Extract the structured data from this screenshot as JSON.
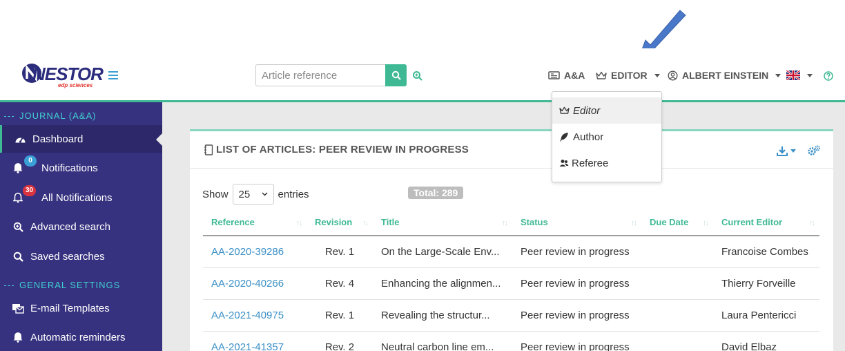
{
  "brand": {
    "name": "NESTOR",
    "sub": "edp sciences"
  },
  "search": {
    "placeholder": "Article reference"
  },
  "nav": {
    "journal": "A&A",
    "role": "EDITOR",
    "user": "ALBERT EINSTEIN"
  },
  "role_menu": {
    "items": [
      {
        "label": "Editor",
        "icon": "crown-icon",
        "selected": true
      },
      {
        "label": "Author",
        "icon": "feather-icon",
        "selected": false
      },
      {
        "label": "Referee",
        "icon": "users-icon",
        "selected": false
      }
    ]
  },
  "sidebar": {
    "section_journal": "JOURNAL (A&A)",
    "section_general": "GENERAL SETTINGS",
    "items": [
      {
        "label": "Dashboard",
        "icon": "dashboard-icon"
      },
      {
        "label": "Notifications",
        "icon": "bell-icon",
        "badge": "0"
      },
      {
        "label": "All Notifications",
        "icon": "bell-outline-icon",
        "badge": "30"
      },
      {
        "label": "Advanced search",
        "icon": "search-plus-icon"
      },
      {
        "label": "Saved searches",
        "icon": "search-icon"
      },
      {
        "label": "E-mail Templates",
        "icon": "email-templates-icon"
      },
      {
        "label": "Automatic reminders",
        "icon": "bell-icon"
      }
    ]
  },
  "panel": {
    "title": "LIST OF ARTICLES: PEER REVIEW IN PROGRESS",
    "show_label": "Show",
    "entries_value": "25",
    "entries_label": "entries",
    "total": "Total: 289"
  },
  "table": {
    "columns": [
      "Reference",
      "Revision",
      "Title",
      "Status",
      "Due Date",
      "Current Editor"
    ],
    "rows": [
      {
        "ref": "AA-2020-39286",
        "rev": "Rev. 1",
        "title": "On the Large-Scale Env...",
        "status": "Peer review in progress",
        "due": "",
        "editor": "Francoise Combes"
      },
      {
        "ref": "AA-2020-40266",
        "rev": "Rev. 4",
        "title": "Enhancing the alignmen...",
        "status": "Peer review in progress",
        "due": "",
        "editor": "Thierry Forveille"
      },
      {
        "ref": "AA-2021-40975",
        "rev": "Rev. 1",
        "title": "Revealing the structur...",
        "status": "Peer review in progress",
        "due": "",
        "editor": "Laura Pentericci"
      },
      {
        "ref": "AA-2021-41357",
        "rev": "Rev. 2",
        "title": "Neutral carbon line em...",
        "status": "Peer review in progress",
        "due": "",
        "editor": "David Elbaz"
      }
    ]
  },
  "colors": {
    "accent": "#3fb994",
    "sidebar": "#37327f",
    "link": "#3a8fc6",
    "arrow": "#4a78c8"
  }
}
